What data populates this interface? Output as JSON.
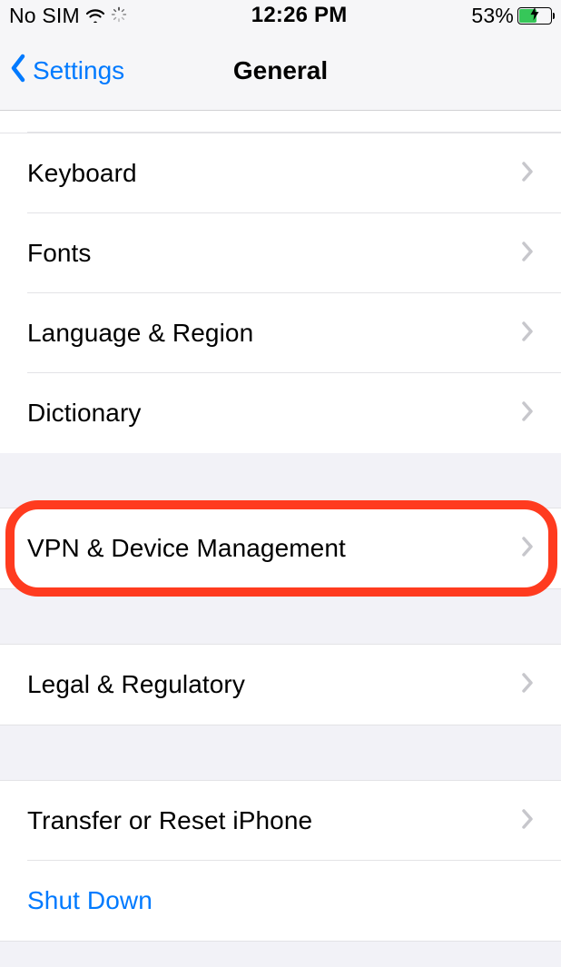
{
  "status": {
    "carrier": "No SIM",
    "time": "12:26 PM",
    "battery_percent": "53%",
    "battery_fill_pct": 53
  },
  "nav": {
    "back_label": "Settings",
    "title": "General"
  },
  "groups": [
    {
      "id": "g1",
      "rows": [
        {
          "id": "keyboard",
          "label": "Keyboard",
          "chevron": true
        },
        {
          "id": "fonts",
          "label": "Fonts",
          "chevron": true
        },
        {
          "id": "language",
          "label": "Language & Region",
          "chevron": true
        },
        {
          "id": "dictionary",
          "label": "Dictionary",
          "chevron": true
        }
      ]
    },
    {
      "id": "g2",
      "rows": [
        {
          "id": "vpn",
          "label": "VPN & Device Management",
          "chevron": true,
          "highlight": true
        }
      ]
    },
    {
      "id": "g3",
      "rows": [
        {
          "id": "legal",
          "label": "Legal & Regulatory",
          "chevron": true
        }
      ]
    },
    {
      "id": "g4",
      "rows": [
        {
          "id": "transfer",
          "label": "Transfer or Reset iPhone",
          "chevron": true
        },
        {
          "id": "shutdown",
          "label": "Shut Down",
          "chevron": false,
          "accent": true
        }
      ]
    }
  ]
}
